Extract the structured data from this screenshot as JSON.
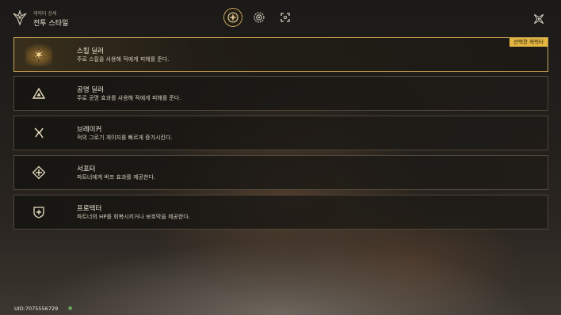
{
  "header": {
    "subtitle": "캐릭터 상세",
    "title": "전투 스타일",
    "tabs": [
      {
        "icon": "compass-icon",
        "active": true
      },
      {
        "icon": "gear-emblem-icon",
        "active": false
      },
      {
        "icon": "expand-icon",
        "active": false
      }
    ],
    "close_icon": "close-star-icon"
  },
  "styles": [
    {
      "name": "스킬 딜러",
      "desc": "주로 스킬을 사용해 적에게 피해를 준다.",
      "icon": "skill-dealer-icon",
      "selected": true,
      "badge": "선택한 캐릭터"
    },
    {
      "name": "공명 딜러",
      "desc": "주로 공명 효과를 사용해 적에게 피해를 준다.",
      "icon": "resonance-dealer-icon",
      "selected": false
    },
    {
      "name": "브레이커",
      "desc": "적의 그로기 게이지를 빠르게 증가시킨다.",
      "icon": "breaker-icon",
      "selected": false
    },
    {
      "name": "서포터",
      "desc": "파트너에게 버프 효과를 제공한다.",
      "icon": "supporter-icon",
      "selected": false
    },
    {
      "name": "프로텍터",
      "desc": "파트너의 HP를 회복시키거나 보호막을 제공한다.",
      "icon": "protector-icon",
      "selected": false
    }
  ],
  "footer": {
    "uid": "UID:7075556729",
    "hint": "●"
  },
  "colors": {
    "accent": "#c9a055",
    "badge": "#e2b641"
  }
}
